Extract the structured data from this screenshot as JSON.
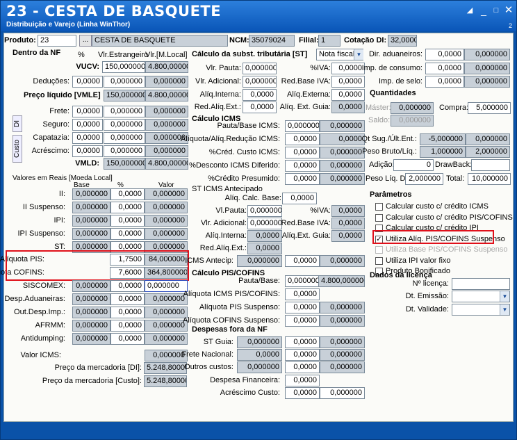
{
  "window": {
    "title": "23 - CESTA DE BASQUETE",
    "subtitle": "Distribuição e Varejo (Linha WinThor)",
    "num": "2",
    "icons": [
      "restore-icon",
      "minimize-icon",
      "maximize-icon",
      "close-icon"
    ]
  },
  "header": {
    "produto_label": "Produto:",
    "produto_code": "23",
    "ellipsis": "...",
    "produto_desc": "CESTA DE BASQUETE",
    "ncm_label": "NCM:",
    "ncm": "35079024",
    "filial_label": "Filial:",
    "filial": "1",
    "cotacao_label": "Cotação DI:",
    "cotacao": "32,0000"
  },
  "left": {
    "title": "Dentro da NF",
    "pct": "%",
    "col_est": "Vlr.Estrangeiro",
    "col_loc": "Vlr.[M.Local]",
    "vucv_label": "VUCV:",
    "vucv_est": "150,000000",
    "vucv_loc": "4.800,000000",
    "ded_label": "Deduções:",
    "ded_pct": "0,0000",
    "ded_est": "0,000000",
    "ded_loc": "0,000000",
    "pl_label": "Preço líquido [VMLE]",
    "pl_est": "150,000000",
    "pl_loc": "4.800,000000",
    "rows": [
      {
        "label": "Frete:",
        "pct": "0,0000",
        "est": "0,000000",
        "loc": "0,000000"
      },
      {
        "label": "Seguro:",
        "pct": "0,0000",
        "est": "0,000000",
        "loc": "0,000000"
      },
      {
        "label": "Capatazia:",
        "pct": "0,0000",
        "est": "0,000000",
        "loc": "0,000000"
      },
      {
        "label": "Acréscimo:",
        "pct": "0,0000",
        "est": "0,000000",
        "loc": "0,000000"
      }
    ],
    "vmld_label": "VMLD:",
    "vmld_est": "150,000000",
    "vmld_loc": "4.800,000000",
    "tab_di": "DI",
    "tab_custo": "Custo"
  },
  "reais": {
    "title": "Valores em Reais [Moeda Local]",
    "col_base": "Base",
    "col_pct": "%",
    "col_valor": "Valor",
    "rows": [
      {
        "label": "II:",
        "base": "0,000000",
        "pct": "0,0000",
        "valor": "0,000000"
      },
      {
        "label": "II Suspenso:",
        "base": "0,000000",
        "pct": "0,0000",
        "valor": "0,000000"
      },
      {
        "label": "IPI:",
        "base": "0,000000",
        "pct": "0,0000",
        "valor": "0,000000"
      },
      {
        "label": "IPI Suspenso:",
        "base": "0,000000",
        "pct": "0,0000",
        "valor": "0,000000"
      },
      {
        "label": "ST:",
        "base": "0,000000",
        "pct": "0,0000",
        "valor": "0,000000"
      }
    ],
    "pis_label": "Alíquota PIS:",
    "pis_pct": "1,7500",
    "pis_valor": "84,000000",
    "cofins_label": "Alíquota COFINS:",
    "cofins_pct": "7,6000",
    "cofins_valor": "364,800000",
    "rows2": [
      {
        "label": "SISCOMEX:",
        "base": "0,000000",
        "pct": "0,0000",
        "valor": "0,000000"
      },
      {
        "label": "Desp.Aduaneiras:",
        "base": "0,000000",
        "pct": "0,0000",
        "valor": "0,000000"
      },
      {
        "label": "Out.Desp.Imp.:",
        "base": "0,000000",
        "pct": "0,0000",
        "valor": "0,000000"
      },
      {
        "label": "AFRMM:",
        "base": "0,000000",
        "pct": "0,0000",
        "valor": "0,000000"
      },
      {
        "label": "Antidumping:",
        "base": "0,000000",
        "pct": "0,0000",
        "valor": "0,000000"
      }
    ],
    "icms_label": "Valor ICMS:",
    "icms": "0,000000",
    "pm_di_label": "Preço da mercadoria [DI]:",
    "pm_di": "5.248,800000",
    "pm_custo_label": "Preço da mercadoria [Custo]:",
    "pm_custo": "5.248,800000"
  },
  "st": {
    "title": "Cálculo da subst. tributária [ST]",
    "select": "Nota fiscal",
    "pauta_label": "Vlr. Pauta:",
    "pauta": "0,000000",
    "iva_label": "%IVA:",
    "iva": "0,0000",
    "adic_label": "Vlr. Adicional:",
    "adic": "0,000000",
    "redbase_label": "Red.Base IVA:",
    "redbase": "0,0000",
    "aliqint_label": "Alíq.Interna:",
    "aliqint": "0,0000",
    "aliqext_label": "Alíq.Externa:",
    "aliqext": "0,0000",
    "redext_label": "Red.Alíq.Ext.:",
    "redext": "0,0000",
    "aliqguia_label": "Alíq. Ext. Guia:",
    "aliqguia": "0,0000"
  },
  "icms": {
    "title": "Cálculo ICMS",
    "rows": [
      {
        "label": "Pauta/Base ICMS:",
        "v1": "0,000000",
        "v2": "0,000000"
      },
      {
        "label": "Alíquota/Alíq.Redução ICMS:",
        "v1": "0,0000",
        "v2": "0,0000"
      },
      {
        "label": "%Créd. Custo ICMS:",
        "v1": "0,0000",
        "v2": "0,000000"
      },
      {
        "label": "%Desconto ICMS Diferido:",
        "v1": "0,0000",
        "v2": "0,000000"
      },
      {
        "label": "%Crédito Presumido:",
        "v1": "0,0000",
        "v2": "0,000000"
      }
    ]
  },
  "stant": {
    "title": "ST ICMS Antecipado",
    "calc_label": "Alíq. Calc. Base:",
    "calc": "0,0000",
    "pauta_label": "Vl.Pauta:",
    "pauta": "0,000000",
    "iva_label": "%IVA:",
    "iva": "0,0000",
    "adic_label": "Vlr. Adicional:",
    "adic": "0,000000",
    "redbase_label": "Red.Base IVA:",
    "redbase": "0,0000",
    "int_label": "Alíq.Interna:",
    "int": "0,0000",
    "guia_label": "Alíq.Ext. Guia:",
    "guia": "0,0000",
    "redext_label": "Red.Alíq.Ext.:",
    "redext": "0,0000",
    "antecip_label": "ICMS Antecip:",
    "antecip1": "0,000000",
    "antecip2": "0,0000",
    "antecip3": "0,000000"
  },
  "pis": {
    "title": "Cálculo PIS/COFINS",
    "base_label": "Pauta/Base:",
    "base1": "0,000000",
    "base2": "4.800,000000",
    "rows": [
      {
        "label": "Alíquota ICMS PIS/COFINS:",
        "v1": "0,0000",
        "v2": ""
      },
      {
        "label": "Alíquota PIS Suspenso:",
        "v1": "0,0000",
        "v2": "0,000000"
      },
      {
        "label": "Alíquota COFINS Suspenso:",
        "v1": "0,0000",
        "v2": "0,000000"
      }
    ]
  },
  "despesas": {
    "title": "Despesas fora da NF",
    "rows": [
      {
        "label": "ST Guia:",
        "v1": "0,000000",
        "v2": "0,0000",
        "v3": "0,000000"
      },
      {
        "label": "Frete Nacional:",
        "v1": "0,0000",
        "v2": "0,0000",
        "v3": "0,000000"
      },
      {
        "label": "Outros custos:",
        "v1": "0,000000",
        "v2": "0,0000",
        "v3": "0,000000"
      }
    ],
    "fin_label": "Despesa Financeira:",
    "fin": "0,0000",
    "acr_label": "Acréscimo Custo:",
    "acr1": "0,0000",
    "acr2": "0,000000"
  },
  "right": {
    "adu_label": "Dir. aduaneiros:",
    "adu1": "0,0000",
    "adu2": "0,000000",
    "cons_label": "Imp. de consumo:",
    "cons1": "0,0000",
    "cons2": "0,000000",
    "selo_label": "Imp. de selo:",
    "selo1": "0,0000",
    "selo2": "0,000000",
    "qtd_title": "Quantidades",
    "master_label": "Máster:",
    "master": "0,000000",
    "compra_label": "Compra:",
    "compra": "5,000000",
    "saldo_label": "Saldo:",
    "saldo": "0,000000",
    "qtsug_label": "Qt Sug./Últ.Ent.:",
    "qtsug1": "-5,000000",
    "qtsug2": "0,000000",
    "peso_label": "Peso Bruto/Líq.:",
    "peso1": "1,000000",
    "peso2": "2,000000",
    "adicao_label": "Adição:",
    "adicao": "0",
    "drawback_label": "DrawBack:",
    "drawback": "",
    "pesodi_label": "Peso Líq. DI:",
    "pesodi": "2,000000",
    "total_label": "Total:",
    "total": "10,000000",
    "param_title": "Parâmetros",
    "params": [
      {
        "label": "Calcular custo c/ crédito ICMS",
        "checked": false,
        "disabled": false
      },
      {
        "label": "Calcular custo c/ crédito PIS/COFINS",
        "checked": false,
        "disabled": false
      },
      {
        "label": "Calcular custo c/ crédito IPI",
        "checked": false,
        "disabled": false
      },
      {
        "label": "Utiliza Alíq. PIS/COFINS Suspenso",
        "checked": true,
        "disabled": false
      },
      {
        "label": "Utiliza Base PIS/COFINS Suspenso",
        "checked": false,
        "disabled": true
      },
      {
        "label": "Utiliza IPI valor fixo",
        "checked": false,
        "disabled": false
      },
      {
        "label": "Produto Bonificado",
        "checked": false,
        "disabled": false
      }
    ],
    "lic_title": "Dados da licença",
    "nlic_label": "Nº licença:",
    "nlic": "",
    "emissao_label": "Dt. Emissão:",
    "emissao": "",
    "validade_label": "Dt. Validade:",
    "validade": ""
  }
}
